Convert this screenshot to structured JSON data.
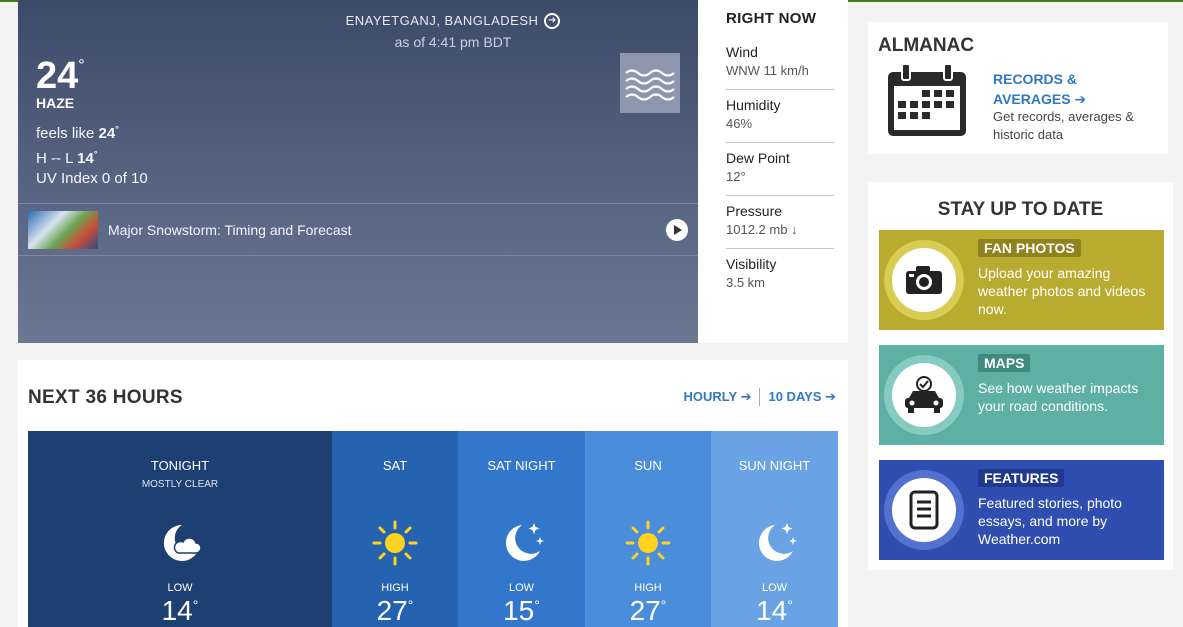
{
  "hero": {
    "location": "ENAYETGANJ, BANGLADESH",
    "as_of": "as of 4:41 pm BDT",
    "temperature": "24",
    "degree": "°",
    "phrase": "HAZE",
    "feels_like_label": "feels like ",
    "feels_like": "24",
    "hi_lo_label": "H -- L ",
    "low": "14",
    "uv": "UV Index 0 of 10",
    "video_title": "Major Snowstorm: Timing and Forecast"
  },
  "right_now": {
    "title": "RIGHT NOW",
    "items": [
      {
        "label": "Wind",
        "value": "WNW 11 km/h"
      },
      {
        "label": "Humidity",
        "value": "46%"
      },
      {
        "label": "Dew Point",
        "value": "12°"
      },
      {
        "label": "Pressure",
        "value": "1012.2 mb ↓"
      },
      {
        "label": "Visibility",
        "value": "3.5 km"
      }
    ]
  },
  "next36": {
    "title": "NEXT 36 HOURS",
    "hourly_link": "HOURLY ➔",
    "tendays_link": "10 DAYS ➔",
    "periods": [
      {
        "name": "TONIGHT",
        "sub": "MOSTLY CLEAR",
        "label": "LOW",
        "temp": "14",
        "icon": "moon-cloud-icon",
        "color": "#1d3f72"
      },
      {
        "name": "SAT",
        "sub": "",
        "label": "HIGH",
        "temp": "27",
        "icon": "sun-icon",
        "color": "#2563b0"
      },
      {
        "name": "SAT NIGHT",
        "sub": "",
        "label": "LOW",
        "temp": "15",
        "icon": "moon-stars-icon",
        "color": "#3377cc"
      },
      {
        "name": "SUN",
        "sub": "",
        "label": "HIGH",
        "temp": "27",
        "icon": "sun-icon",
        "color": "#4a8ddb"
      },
      {
        "name": "SUN NIGHT",
        "sub": "",
        "label": "LOW",
        "temp": "14",
        "icon": "moon-stars-icon",
        "color": "#6aa3e3"
      }
    ]
  },
  "almanac": {
    "title": "ALMANAC",
    "link_line1": "RECORDS &",
    "link_line2": "AVERAGES ➔",
    "desc_line1": "Get records, averages &",
    "desc_line2": "historic data"
  },
  "stay": {
    "title": "STAY UP TO DATE",
    "cards": [
      {
        "tag": "FAN PHOTOS",
        "text": "Upload your amazing weather photos and videos now.",
        "bg": "#b9ab2f",
        "ring": "#d9cc52",
        "tagbg": "#8f8320",
        "icon": "camera-icon"
      },
      {
        "tag": "MAPS",
        "text": "See how weather impacts your road conditions.",
        "bg": "#5fb0a4",
        "ring": "#86cbc1",
        "tagbg": "#3e8a7f",
        "icon": "car-icon"
      },
      {
        "tag": "FEATURES",
        "text": "Featured stories, photo essays, and more by Weather.com",
        "bg": "#2f4eb0",
        "ring": "#5471cf",
        "tagbg": "#1f3a8c",
        "icon": "document-icon"
      }
    ]
  }
}
